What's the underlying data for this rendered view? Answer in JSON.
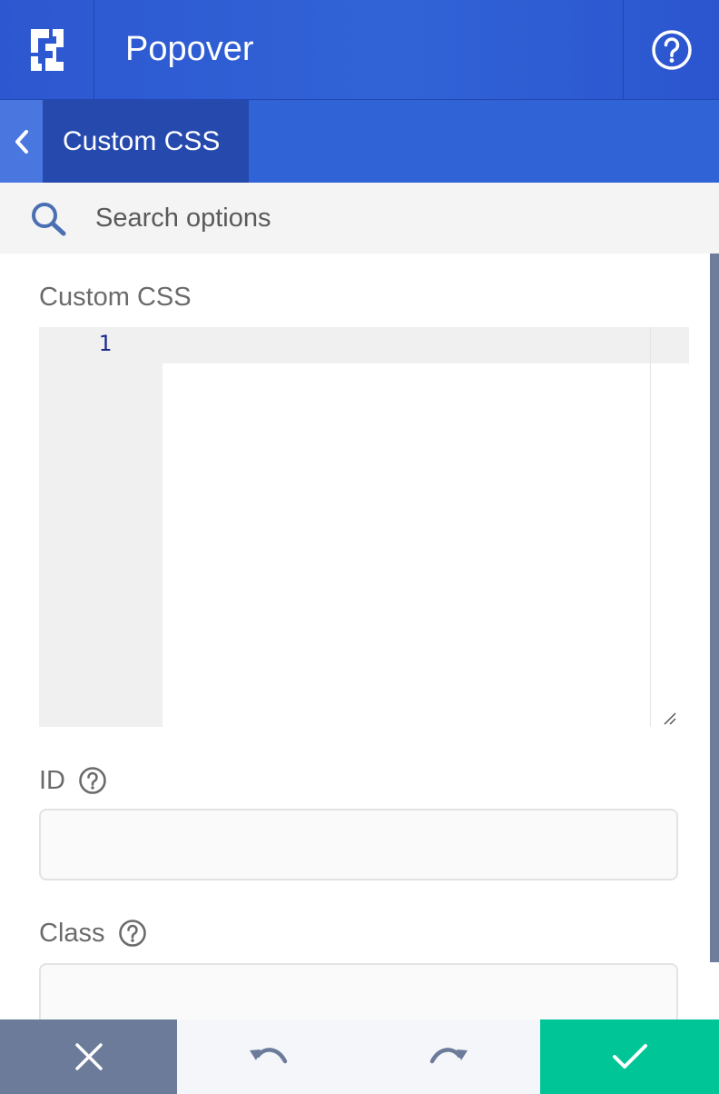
{
  "header": {
    "title": "Popover",
    "logo_icon": "brand-logo-icon",
    "help_icon": "help-circle-icon"
  },
  "breadcrumb": {
    "back_icon": "chevron-left-icon",
    "current": "Custom CSS"
  },
  "search": {
    "placeholder": "Search options",
    "value": ""
  },
  "fields": {
    "custom_css": {
      "label": "Custom CSS",
      "line_numbers": [
        "1"
      ],
      "code": ""
    },
    "id": {
      "label": "ID",
      "value": "",
      "help_icon": "help-circle-icon"
    },
    "class": {
      "label": "Class",
      "value": "",
      "help_icon": "help-circle-icon"
    }
  },
  "footer": {
    "cancel_icon": "close-icon",
    "undo_icon": "undo-icon",
    "redo_icon": "redo-icon",
    "save_icon": "checkmark-icon"
  },
  "colors": {
    "header_bg": "#3063d6",
    "breadcrumb_active_bg": "#2649ad",
    "cancel_bg": "#6b7b99",
    "save_bg": "#00c596",
    "label_text": "#6b6b6b"
  }
}
